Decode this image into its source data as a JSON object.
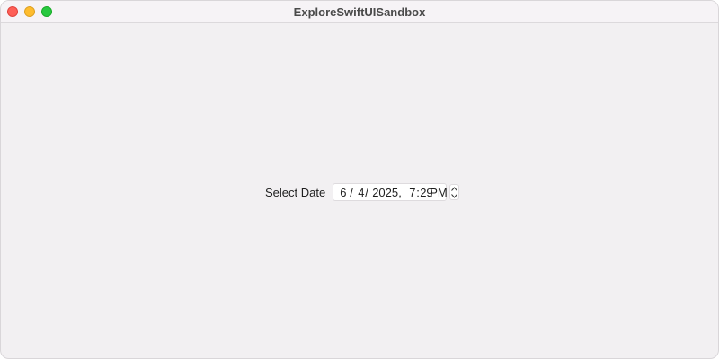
{
  "window": {
    "title": "ExploreSwiftUISandbox",
    "controls": [
      "close",
      "minimize",
      "zoom"
    ]
  },
  "date_picker": {
    "label": "Select Date",
    "month": "6",
    "separator_1": "/",
    "day": "4",
    "separator_2": "/",
    "year": "2025",
    "separator_3": ",",
    "hour": "7",
    "time_separator": ":",
    "minute": "29",
    "ampm": "PM"
  },
  "icons": {
    "stepper_up": "chevron-up-icon",
    "stepper_down": "chevron-down-icon"
  },
  "colors": {
    "window_background": "#f2f0f2",
    "close": "#fe5f57",
    "minimize": "#febc2e",
    "zoom": "#28c840"
  }
}
